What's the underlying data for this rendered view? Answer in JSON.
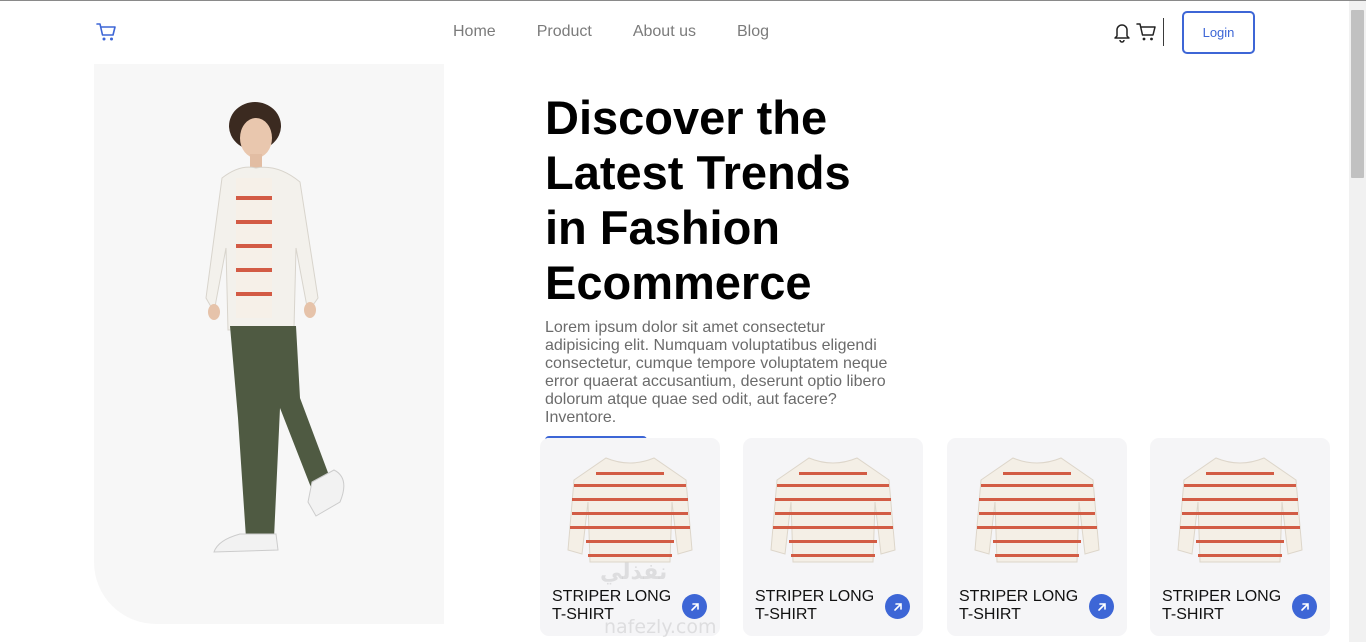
{
  "nav": {
    "items": [
      "Home",
      "Product",
      "About us",
      "Blog"
    ]
  },
  "header": {
    "login_label": "Login"
  },
  "hero": {
    "title_lines": [
      "Discover the",
      "Latest Trends",
      "in Fashion",
      "Ecommerce"
    ],
    "description": "Lorem ipsum dolor sit amet consectetur adipisicing elit. Numquam voluptatibus eligendi consectetur, cumque tempore voluptatem neque error quaerat accusantium, deserunt optio libero dolorum atque quae sed odit, aut facere? Inventore."
  },
  "products": [
    {
      "title_line1": "STRIPER LONG",
      "title_line2": "T-SHIRT"
    },
    {
      "title_line1": "STRIPER LONG",
      "title_line2": "T-SHIRT"
    },
    {
      "title_line1": "STRIPER LONG",
      "title_line2": "T-SHIRT"
    },
    {
      "title_line1": "STRIPER LONG",
      "title_line2": "T-SHIRT"
    }
  ],
  "watermark": {
    "arabic": "نفذلي",
    "latin": "nafezly.com"
  },
  "colors": {
    "accent": "#3d66d6",
    "nav_text": "#7b7b7b",
    "panel_bg": "#f7f7f7",
    "card_bg": "#f5f5f7"
  },
  "icons": {
    "brand": "cart-icon",
    "header_right": [
      "bell-icon",
      "cart-icon"
    ],
    "card_action": "arrow-up-right-icon"
  }
}
